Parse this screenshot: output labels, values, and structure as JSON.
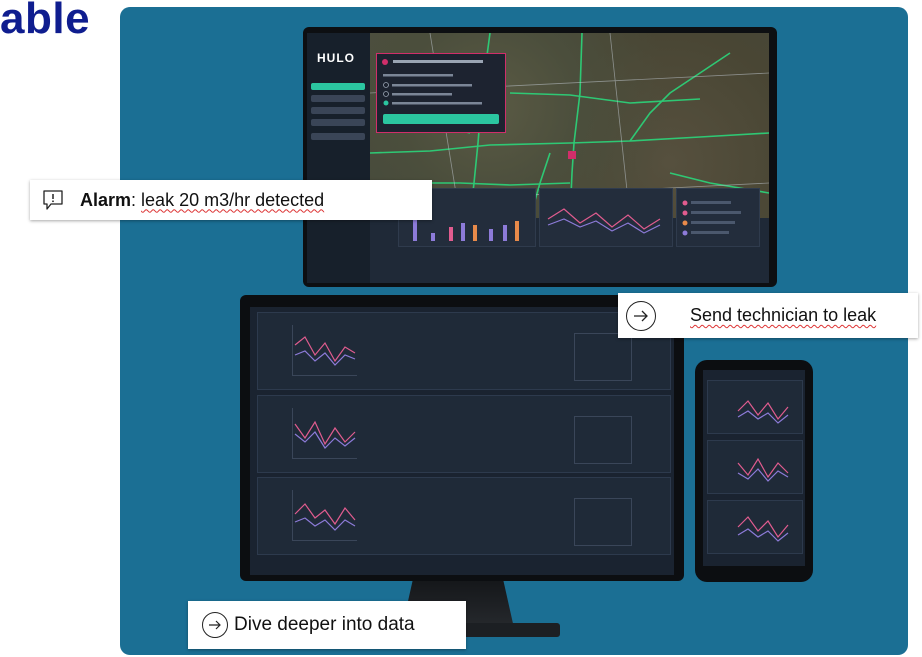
{
  "slide": {
    "title_fragment": "able"
  },
  "app": {
    "logo": "HULO",
    "nav_active_color": "#2bc6a0",
    "alarm_border_color": "#d12e6a"
  },
  "callouts": {
    "alarm": {
      "label": "Alarm",
      "separator": ": ",
      "text_plain": "leak 20 m3/hr detected"
    },
    "send": {
      "text": "Send technician to leak"
    },
    "dive": {
      "text": "Dive deeper into data"
    }
  },
  "icons": {
    "alarm": "speech-bubble-exclamation-icon",
    "arrow": "circled-right-arrow-icon"
  },
  "colors": {
    "panel_bg": "#1b6f94",
    "title": "#0f1d8f",
    "accent_green": "#2bc6a0",
    "alarm_pink": "#d12e6a",
    "map_route": "#2bd67b"
  }
}
